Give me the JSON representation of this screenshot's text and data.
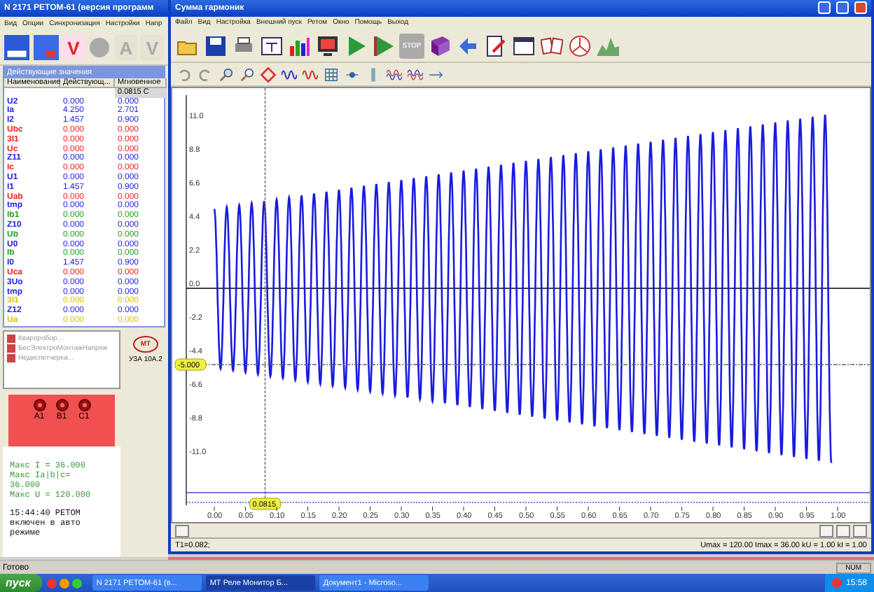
{
  "left_app": {
    "title": "N 2171 PETOM-61 (версия программ",
    "menu": [
      "Вид",
      "Опции",
      "Синхронизация",
      "Настройки",
      "Напр"
    ],
    "meter_buttons": [
      "V",
      "A",
      "V"
    ],
    "panel_title": "Действующие значения",
    "table": {
      "columns": [
        "Наименование",
        "Действующ...",
        "Мгновенное"
      ],
      "time": "0.0815 С",
      "rows": [
        {
          "name": "U2",
          "color": "#2020e0",
          "rms": "0.000",
          "instant": "0.000"
        },
        {
          "name": "Ia",
          "color": "#2020e0",
          "rms": "4.250",
          "instant": "2.701"
        },
        {
          "name": "I2",
          "color": "#2020e0",
          "rms": "1.457",
          "instant": "0.900"
        },
        {
          "name": "Ubc",
          "color": "#f02020",
          "rms": "0.000",
          "instant": "0.000"
        },
        {
          "name": "3I1",
          "color": "#f02020",
          "rms": "0.000",
          "instant": "0.000"
        },
        {
          "name": "Uc",
          "color": "#f02020",
          "rms": "0.000",
          "instant": "0.000"
        },
        {
          "name": "Z11",
          "color": "#2020e0",
          "rms": "0.000",
          "instant": "0.000"
        },
        {
          "name": "Ic",
          "color": "#f02020",
          "rms": "0.000",
          "instant": "0.000"
        },
        {
          "name": "U1",
          "color": "#2020e0",
          "rms": "0.000",
          "instant": "0.000"
        },
        {
          "name": "I1",
          "color": "#2020e0",
          "rms": "1.457",
          "instant": "0.900"
        },
        {
          "name": "Uab",
          "color": "#f02020",
          "rms": "0.000",
          "instant": "0.000"
        },
        {
          "name": "tmp",
          "color": "#2020e0",
          "rms": "0.000",
          "instant": "0.000"
        },
        {
          "name": "Ib1",
          "color": "#20a020",
          "rms": "0.000",
          "instant": "0.000"
        },
        {
          "name": "Z10",
          "color": "#2020e0",
          "rms": "0.000",
          "instant": "0.000"
        },
        {
          "name": "Ub",
          "color": "#20a020",
          "rms": "0.000",
          "instant": "0.000"
        },
        {
          "name": "U0",
          "color": "#2020e0",
          "rms": "0.000",
          "instant": "0.000"
        },
        {
          "name": "Ib",
          "color": "#20a020",
          "rms": "0.000",
          "instant": "0.000"
        },
        {
          "name": "I0",
          "color": "#2020e0",
          "rms": "1.457",
          "instant": "0.900"
        },
        {
          "name": "Uca",
          "color": "#f02020",
          "rms": "0.000",
          "instant": "0.000"
        },
        {
          "name": "3Uo",
          "color": "#2020e0",
          "rms": "0.000",
          "instant": "0.000"
        },
        {
          "name": "tmp",
          "color": "#2020e0",
          "rms": "0.000",
          "instant": "0.000"
        },
        {
          "name": "3I1",
          "color": "#e0c000",
          "rms": "0.000",
          "instant": "0.000"
        },
        {
          "name": "Z12",
          "color": "#2020e0",
          "rms": "0.000",
          "instant": "0.000"
        },
        {
          "name": "Ua",
          "color": "#e0c000",
          "rms": "0.000",
          "instant": "0.000"
        }
      ]
    },
    "tree_items": [
      "Кварпробор...",
      "БесЭлектроМонтажНапряж",
      "Недиспетчерка..."
    ],
    "terminals": [
      "A1",
      "B1",
      "C1"
    ],
    "limits": [
      "Макс I = 36.000",
      "Макс Ia|b|c=",
      "36.000",
      "Макс U = 120.000"
    ],
    "events": [
      "15:44:40 PETOM",
      "включен в авто",
      "режиме"
    ],
    "logo": "МТ",
    "device_label": "УЗА 10А.2"
  },
  "main_window": {
    "title": "Сумма гармоник",
    "menu": [
      "Файл",
      "Вид",
      "Настройка",
      "Внешний пуск",
      "Ретом",
      "Окно",
      "Помощь",
      "Выход"
    ],
    "stop_button": "STOP",
    "chart": {
      "y_ticks": [
        "11.0",
        "8.8",
        "6.6",
        "4.4",
        "2.2",
        "0.0",
        "-2.2",
        "-4.4",
        "-6.6",
        "-8.8",
        "-11.0"
      ],
      "x_ticks": [
        "0.00",
        "0.05",
        "0.10",
        "0.15",
        "0.20",
        "0.25",
        "0.30",
        "0.35",
        "0.40",
        "0.45",
        "0.50",
        "0.55",
        "0.60",
        "0.65",
        "0.70",
        "0.75",
        "0.80",
        "0.85",
        "0.90",
        "0.95",
        "1.00"
      ],
      "level_marker": "-5.000",
      "cursor_marker": "0.0815"
    },
    "cursor_readout": "T1=0.082;",
    "limits": "Umax = 120.00 Imax = 36.00  kU = 1.00 kI = 1.00"
  },
  "status_bar": {
    "text": "Готово",
    "indicator": "NUM"
  },
  "taskbar": {
    "start": "пуск",
    "tasks": [
      {
        "label": "N 2171 PETOM-61 (в...",
        "selected": false
      },
      {
        "label": "МТ Реле Монитор Б...",
        "selected": true
      },
      {
        "label": "Документ1 - Microso...",
        "selected": false
      }
    ],
    "clock": "15:58"
  }
}
